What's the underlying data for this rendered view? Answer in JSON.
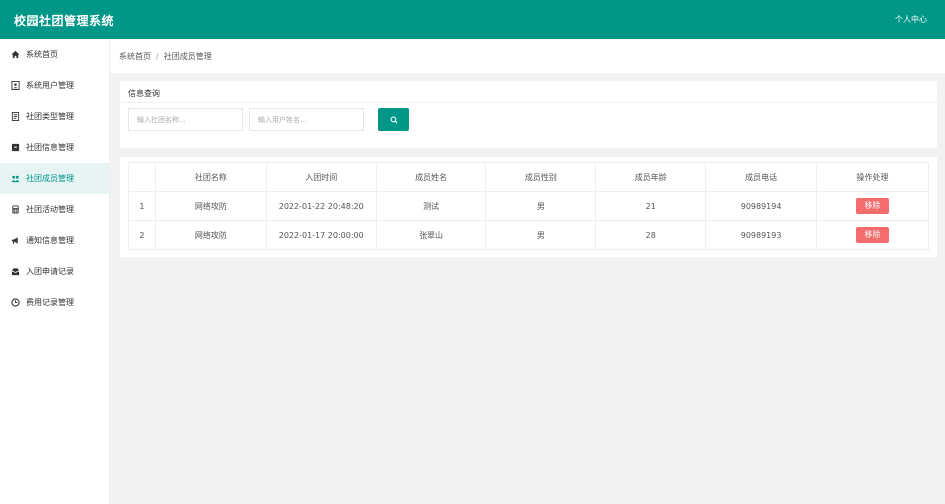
{
  "header": {
    "title": "校园社团管理系统",
    "user_center": "个人中心"
  },
  "sidebar": {
    "items": [
      {
        "label": "系统首页",
        "icon": "home-icon"
      },
      {
        "label": "系统用户管理",
        "icon": "user-card-icon"
      },
      {
        "label": "社团类型管理",
        "icon": "document-icon"
      },
      {
        "label": "社团信息管理",
        "icon": "archive-icon"
      },
      {
        "label": "社团成员管理",
        "icon": "group-icon"
      },
      {
        "label": "社团活动管理",
        "icon": "calculator-icon"
      },
      {
        "label": "通知信息管理",
        "icon": "megaphone-icon"
      },
      {
        "label": "入团申请记录",
        "icon": "inbox-icon"
      },
      {
        "label": "费用记录管理",
        "icon": "clock-icon"
      }
    ],
    "active_index": 4
  },
  "breadcrumb": {
    "home": "系统首页",
    "separator": "/",
    "current": "社团成员管理"
  },
  "search": {
    "title": "信息查询",
    "club_placeholder": "输入社团名称...",
    "user_placeholder": "输入用户姓名..."
  },
  "table": {
    "columns": [
      "",
      "社团名称",
      "入团时间",
      "成员姓名",
      "成员性别",
      "成员年龄",
      "成员电话",
      "操作处理"
    ],
    "rows": [
      {
        "index": "1",
        "club": "网络攻防",
        "join_time": "2022-01-22 20:48:20",
        "name": "测试",
        "gender": "男",
        "age": "21",
        "phone": "90989194",
        "action": "移除"
      },
      {
        "index": "2",
        "club": "网络攻防",
        "join_time": "2022-01-17 20:00:00",
        "name": "张翠山",
        "gender": "男",
        "age": "28",
        "phone": "90989193",
        "action": "移除"
      }
    ]
  },
  "colors": {
    "primary": "#009688",
    "danger": "#f56c6c",
    "background": "#f2f2f2"
  }
}
